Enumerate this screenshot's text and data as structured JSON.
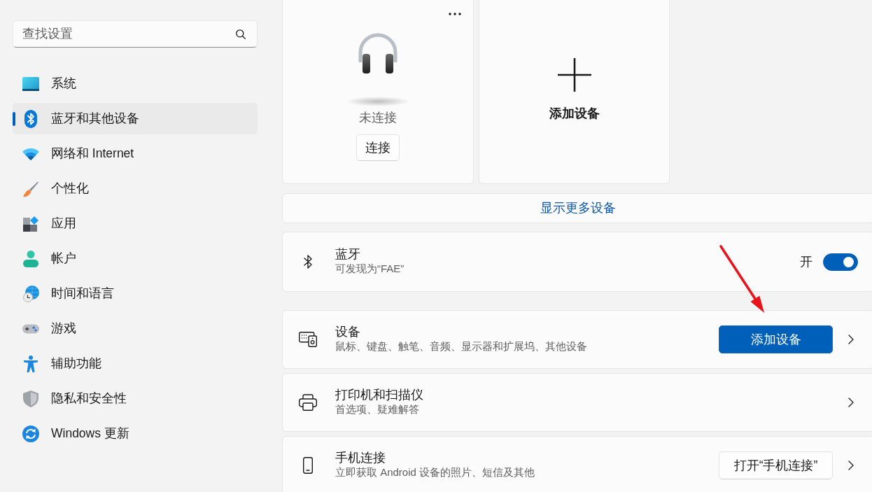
{
  "search": {
    "placeholder": "查找设置"
  },
  "nav": [
    {
      "kind": "system",
      "label": "系统",
      "selected": false
    },
    {
      "kind": "bluetooth",
      "label": "蓝牙和其他设备",
      "selected": true
    },
    {
      "kind": "network",
      "label": "网络和 Internet",
      "selected": false
    },
    {
      "kind": "personalization",
      "label": "个性化",
      "selected": false
    },
    {
      "kind": "apps",
      "label": "应用",
      "selected": false
    },
    {
      "kind": "accounts",
      "label": "帐户",
      "selected": false
    },
    {
      "kind": "time",
      "label": "时间和语言",
      "selected": false
    },
    {
      "kind": "gaming",
      "label": "游戏",
      "selected": false
    },
    {
      "kind": "accessibility",
      "label": "辅助功能",
      "selected": false
    },
    {
      "kind": "privacy",
      "label": "隐私和安全性",
      "selected": false
    },
    {
      "kind": "update",
      "label": "Windows 更新",
      "selected": false
    }
  ],
  "device_cards": [
    {
      "kind": "device",
      "status": "未连接",
      "button": "连接"
    },
    {
      "kind": "add",
      "label": "添加设备"
    }
  ],
  "show_more": {
    "label": "显示更多设备"
  },
  "bluetooth": {
    "title": "蓝牙",
    "subtitle": "可发现为“FAE”",
    "state_label": "开",
    "on": true
  },
  "rows": [
    {
      "kind": "devices",
      "title": "设备",
      "subtitle": "鼠标、键盘、触笔、音频、显示器和扩展坞、其他设备",
      "button": "添加设备"
    },
    {
      "kind": "printer",
      "title": "打印机和扫描仪",
      "subtitle": "首选项、疑难解答"
    },
    {
      "kind": "phone",
      "title": "手机连接",
      "subtitle": "立即获取 Android 设备的照片、短信及其他",
      "button": "打开“手机连接”"
    }
  ]
}
